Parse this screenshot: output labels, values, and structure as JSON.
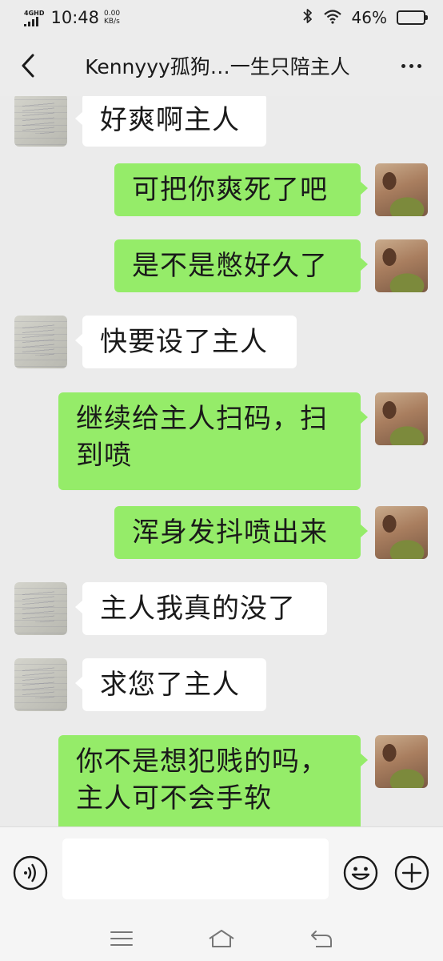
{
  "status_bar": {
    "network": "4GHD",
    "time": "10:48",
    "speed_value": "0.00",
    "speed_unit": "KB/s",
    "battery_percent": "46%",
    "battery_level": 0.46
  },
  "header": {
    "title": "Kennyyy孤狗…一生只陪主人"
  },
  "messages": [
    {
      "side": "in",
      "text": "好爽啊主人"
    },
    {
      "side": "out",
      "text": "可把你爽死了吧"
    },
    {
      "side": "out",
      "text": "是不是憋好久了"
    },
    {
      "side": "in",
      "text": "快要设了主人"
    },
    {
      "side": "out",
      "line1": "继续给主人扫码，扫",
      "line2": "到喷"
    },
    {
      "side": "out",
      "text": "浑身发抖喷出来"
    },
    {
      "side": "in",
      "text": "主人我真的没了"
    },
    {
      "side": "in",
      "text": "求您了主人"
    },
    {
      "side": "out",
      "line1": "你不是想犯贱的吗，",
      "line2": "主人可不会手软"
    }
  ],
  "input": {
    "value": "",
    "placeholder": ""
  },
  "icons": {
    "back": "chevron-left-icon",
    "more": "more-dots-icon",
    "voice": "voice-icon",
    "emoji": "emoji-icon",
    "plus": "plus-icon",
    "nav_menu": "menu-icon",
    "nav_home": "home-icon",
    "nav_back": "back-icon"
  },
  "colors": {
    "background": "#ebebeb",
    "outgoing_bubble": "#95ec69",
    "incoming_bubble": "#ffffff"
  }
}
